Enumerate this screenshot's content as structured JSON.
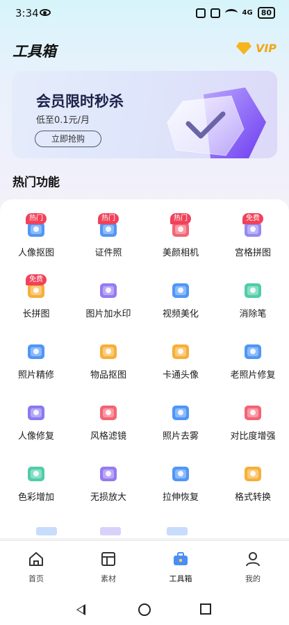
{
  "status_bar": {
    "time": "3:34",
    "signal": "4G",
    "battery": "80"
  },
  "header": {
    "title": "工具箱",
    "vip_label": "VIP"
  },
  "banner": {
    "title": "会员限时秒杀",
    "subtitle": "低至0.1元/月",
    "button": "立即抢购"
  },
  "section": {
    "title": "热门功能"
  },
  "tools": [
    {
      "label": "人像抠图",
      "badge": "热门",
      "icon": "portrait-cutout-icon",
      "color": "#3d8bf5"
    },
    {
      "label": "证件照",
      "badge": "热门",
      "icon": "id-photo-icon",
      "color": "#3d8bf5"
    },
    {
      "label": "美颜相机",
      "badge": "热门",
      "icon": "beauty-camera-icon",
      "color": "#f25366"
    },
    {
      "label": "宫格拼图",
      "badge": "免费",
      "icon": "grid-collage-icon",
      "color": "#8a7cf4"
    },
    {
      "label": "长拼图",
      "badge": "免费",
      "icon": "long-collage-icon",
      "color": "#f5a623"
    },
    {
      "label": "图片加水印",
      "badge": "",
      "icon": "watermark-icon",
      "color": "#8a6cf0"
    },
    {
      "label": "视频美化",
      "badge": "",
      "icon": "video-enhance-icon",
      "color": "#3d8bf5"
    },
    {
      "label": "消除笔",
      "badge": "",
      "icon": "eraser-pen-icon",
      "color": "#3cc8a0"
    },
    {
      "label": "照片精修",
      "badge": "",
      "icon": "photo-retouch-icon",
      "color": "#3d8bf5"
    },
    {
      "label": "物品抠图",
      "badge": "",
      "icon": "object-cutout-icon",
      "color": "#f5a623"
    },
    {
      "label": "卡通头像",
      "badge": "",
      "icon": "cartoon-avatar-icon",
      "color": "#f5a623"
    },
    {
      "label": "老照片修复",
      "badge": "",
      "icon": "old-photo-repair-icon",
      "color": "#3d8bf5"
    },
    {
      "label": "人像修复",
      "badge": "",
      "icon": "portrait-repair-icon",
      "color": "#7c6cf0"
    },
    {
      "label": "风格滤镜",
      "badge": "",
      "icon": "style-filter-icon",
      "color": "#f25366"
    },
    {
      "label": "照片去雾",
      "badge": "",
      "icon": "dehaze-icon",
      "color": "#3d8bf5"
    },
    {
      "label": "对比度增强",
      "badge": "",
      "icon": "contrast-icon",
      "color": "#f25366"
    },
    {
      "label": "色彩增加",
      "badge": "",
      "icon": "color-boost-icon",
      "color": "#3cc8a0"
    },
    {
      "label": "无损放大",
      "badge": "",
      "icon": "lossless-zoom-icon",
      "color": "#8a6cf0"
    },
    {
      "label": "拉伸恢复",
      "badge": "",
      "icon": "stretch-restore-icon",
      "color": "#3d8bf5"
    },
    {
      "label": "格式转换",
      "badge": "",
      "icon": "format-convert-icon",
      "color": "#f5a623"
    }
  ],
  "tabs": [
    {
      "label": "首页",
      "icon": "home-icon"
    },
    {
      "label": "素材",
      "icon": "material-icon"
    },
    {
      "label": "工具箱",
      "icon": "toolbox-icon",
      "active": true
    },
    {
      "label": "我的",
      "icon": "profile-icon"
    }
  ]
}
